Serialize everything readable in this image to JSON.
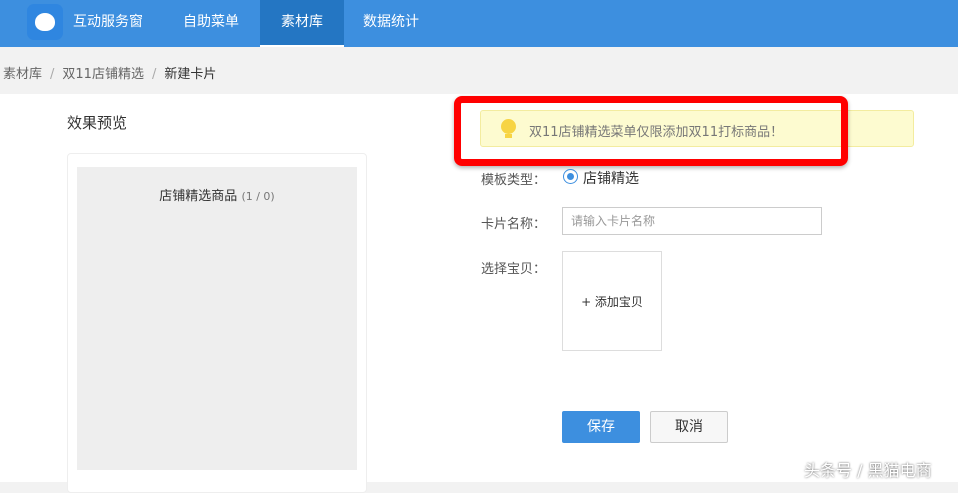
{
  "nav": {
    "brand": "互动服务窗",
    "items": [
      "自助菜单",
      "素材库",
      "数据统计"
    ],
    "active": "素材库"
  },
  "breadcrumb": [
    "素材库",
    "双11店铺精选",
    "新建卡片"
  ],
  "preview": {
    "title": "效果预览",
    "heading": "店铺精选商品",
    "count": "(1 / 0)"
  },
  "notice": {
    "text": "双11店铺精选菜单仅限添加双11打标商品！"
  },
  "form": {
    "template_label": "模板类型：",
    "template_value": "店铺精选",
    "name_label": "卡片名称：",
    "name_placeholder": "请输入卡片名称",
    "name_value": "",
    "item_label": "选择宝贝：",
    "add_item": "+ 添加宝贝"
  },
  "buttons": {
    "save": "保存",
    "cancel": "取消"
  },
  "watermark": "头条号 / 黑猫电商",
  "colors": {
    "accent": "#3d8fdf",
    "highlight": "#ff0000"
  }
}
